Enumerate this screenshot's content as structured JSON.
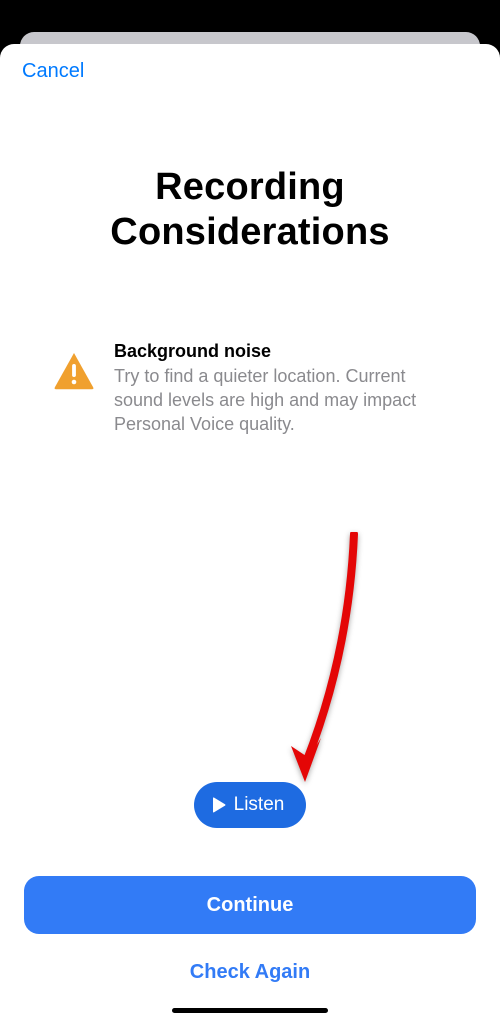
{
  "nav": {
    "cancel_label": "Cancel"
  },
  "title": "Recording Considerations",
  "info": {
    "heading": "Background noise",
    "description": "Try to find a quieter location. Current sound levels are high and may impact Personal Voice quality."
  },
  "listen": {
    "label": "Listen"
  },
  "footer": {
    "continue_label": "Continue",
    "check_again_label": "Check Again"
  }
}
